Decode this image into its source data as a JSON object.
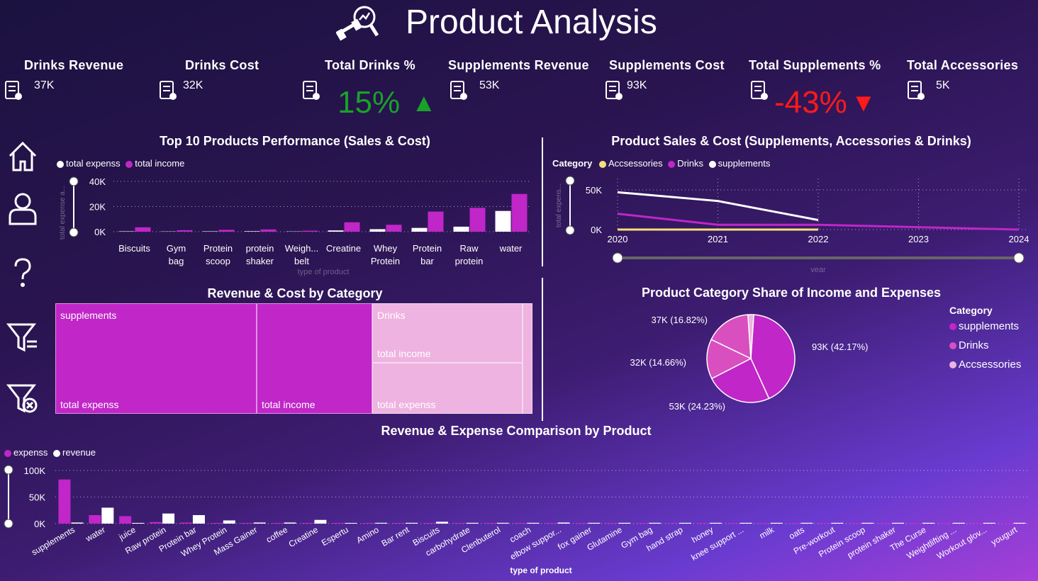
{
  "page_title": "Product Analysis",
  "kpis": [
    {
      "label": "Drinks Revenue",
      "value": "37K",
      "icon": "receipt-icon"
    },
    {
      "label": "Drinks Cost",
      "value": "32K",
      "icon": "bottles-cost-icon"
    },
    {
      "label": "Total Drinks %",
      "value": "15%",
      "icon": "percent-doc-icon",
      "arrow": "▲"
    },
    {
      "label": "Supplements Revenue",
      "value": "53K",
      "icon": "supplement-revenue-icon"
    },
    {
      "label": "Supplements Cost",
      "value": "93K",
      "icon": "supplement-cost-icon"
    },
    {
      "label": "Total Supplements %",
      "value": "-43%",
      "icon": "percent-doc-icon",
      "arrow": "▼"
    },
    {
      "label": "Total Accessories",
      "value": "5K",
      "icon": "accessories-icon"
    }
  ],
  "colors": {
    "magenta": "#c026c8",
    "white": "#ffffff",
    "light_pink": "#eeb3e0",
    "green": "#1aa12a",
    "red": "#ff1a1a",
    "yellow": "#f5e07a",
    "mid_pink": "#d94fc0"
  },
  "nav": [
    "home-icon",
    "user-icon",
    "help-icon",
    "filter-icon",
    "clear-filter-icon"
  ],
  "chart_data": [
    {
      "id": "top10",
      "type": "bar",
      "title": "Top 10 Products Performance (Sales & Cost)",
      "xlabel": "type of product",
      "ylabel": "total expense a...",
      "yticks": [
        "40K",
        "20K",
        "0K"
      ],
      "ylim": [
        0,
        40000
      ],
      "categories": [
        "Biscuits",
        "Gym bag",
        "Protein scoop",
        "protein shaker",
        "Weigh... belt",
        "Creatine",
        "Whey Protein",
        "Protein bar",
        "Raw protein",
        "water"
      ],
      "category_lines": [
        [
          "Biscuits"
        ],
        [
          "Gym",
          "bag"
        ],
        [
          "Protein",
          "scoop"
        ],
        [
          "protein",
          "shaker"
        ],
        [
          "Weigh...",
          "belt"
        ],
        [
          "Creatine"
        ],
        [
          "Whey",
          "Protein"
        ],
        [
          "Protein",
          "bar"
        ],
        [
          "Raw",
          "protein"
        ],
        [
          "water"
        ]
      ],
      "series": [
        {
          "name": "total expenss",
          "values": [
            300,
            200,
            300,
            400,
            200,
            1000,
            2000,
            3000,
            4000,
            16500
          ]
        },
        {
          "name": "total income",
          "values": [
            3500,
            1200,
            1500,
            1800,
            800,
            7500,
            5500,
            16000,
            19000,
            30000
          ]
        }
      ]
    },
    {
      "id": "lines",
      "type": "line",
      "title": "Product Sales & Cost (Supplements, Accessories & Drinks)",
      "legend_title": "Category",
      "xlabel": "year",
      "ylabel": "total expens...",
      "x": [
        "2020",
        "2021",
        "2022",
        "2023",
        "2024"
      ],
      "yticks": [
        "50K",
        "0K"
      ],
      "ylim": [
        0,
        50000
      ],
      "series": [
        {
          "name": "Accsessories",
          "values": [
            0,
            0,
            0,
            null,
            null
          ]
        },
        {
          "name": "Drinks",
          "values": [
            20000,
            6000,
            6000,
            3000,
            0
          ]
        },
        {
          "name": "supplements",
          "values": [
            47000,
            36000,
            12000,
            null,
            null
          ]
        }
      ]
    },
    {
      "id": "treemap",
      "type": "treemap",
      "title": "Revenue & Cost by Category",
      "labels": {
        "supplements": "supplements",
        "drinks": "Drinks",
        "income": "total income",
        "expense": "total expenss"
      },
      "values": {
        "supplements": {
          "total expenss": 93000,
          "total income": 53000
        },
        "Drinks": {
          "total income": 37000,
          "total expenss": 32000
        },
        "Accsessories": 5000
      }
    },
    {
      "id": "pie",
      "type": "pie",
      "title": "Product Category Share of Income and Expenses",
      "legend_title": "Category",
      "legend": [
        "supplements",
        "Drinks",
        "Accsessories"
      ],
      "slices": [
        {
          "label": "93K (42.17%)",
          "value": 93000,
          "share": 42.17
        },
        {
          "label": "53K (24.23%)",
          "value": 53000,
          "share": 24.23
        },
        {
          "label": "32K (14.66%)",
          "value": 32000,
          "share": 14.66
        },
        {
          "label": "37K (16.82%)",
          "value": 37000,
          "share": 16.82
        },
        {
          "value": 4700,
          "share": 2.12
        }
      ]
    },
    {
      "id": "comparison",
      "type": "bar",
      "title": "Revenue & Expense Comparison by Product",
      "xlabel": "type of product",
      "yticks": [
        "100K",
        "50K",
        "0K"
      ],
      "ylim": [
        0,
        100000
      ],
      "categories": [
        "supplements",
        "water",
        "juice",
        "Raw protein",
        "Protein bar",
        "Whey Protein",
        "Mass Gainer",
        "coffee",
        "Creatine",
        "Espertu",
        "Amino",
        "Bar rent",
        "Biscuits",
        "carbohydrate",
        "Clenbuterol",
        "coach",
        "elbow suppor...",
        "fox gainer",
        "Glutamine",
        "Gym bag",
        "hand strap",
        "honey",
        "knee support ...",
        "milk",
        "oats",
        "Pre-workout",
        "Protein scoop",
        "protein shaker",
        "The Curse",
        "Weightlifting ...",
        "Workout glov...",
        "yougurt"
      ],
      "series": [
        {
          "name": "expenss",
          "values": [
            83000,
            16000,
            14000,
            3000,
            2000,
            1000,
            500,
            1000,
            1000,
            500,
            300,
            300,
            500,
            300,
            300,
            300,
            300,
            300,
            300,
            300,
            300,
            300,
            300,
            300,
            300,
            300,
            300,
            300,
            300,
            300,
            300,
            300
          ]
        },
        {
          "name": "revenue",
          "values": [
            2000,
            30000,
            1000,
            19000,
            16000,
            6000,
            2000,
            2000,
            7000,
            1000,
            1500,
            1500,
            3500,
            1500,
            1500,
            1500,
            2000,
            1500,
            1500,
            1500,
            1500,
            1500,
            1500,
            1500,
            1500,
            1500,
            1500,
            1500,
            1500,
            1500,
            1500,
            1500
          ]
        }
      ]
    }
  ]
}
